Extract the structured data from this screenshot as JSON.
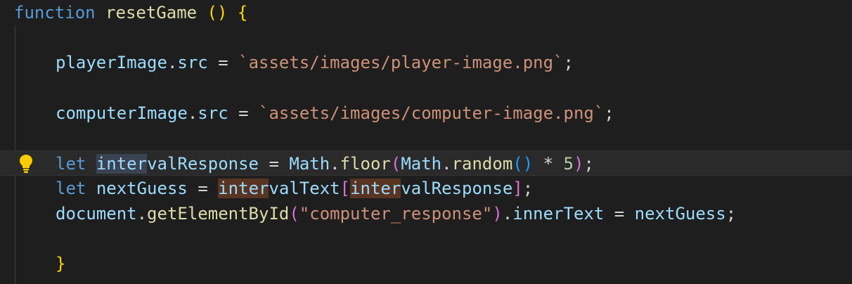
{
  "editor": {
    "lines": [
      {
        "tokens": [
          "function",
          "resetGame",
          "(",
          ")",
          "{"
        ]
      },
      {
        "tokens": []
      },
      {
        "tokens": [
          "playerImage",
          ".",
          "src",
          "=",
          "`assets/images/player-image.png`",
          ";"
        ]
      },
      {
        "tokens": []
      },
      {
        "tokens": [
          "computerImage",
          ".",
          "src",
          "=",
          "`assets/images/computer-image.png`",
          ";"
        ]
      },
      {
        "tokens": []
      },
      {
        "tokens": [
          "let",
          "inter",
          "valResponse",
          "=",
          "Math",
          ".",
          "floor",
          "(",
          "Math",
          ".",
          "random",
          "(",
          ")",
          "*",
          "5",
          ")",
          ";"
        ]
      },
      {
        "tokens": [
          "let",
          "nextGuess",
          "=",
          "inter",
          "valText",
          "[",
          "inter",
          "valResponse",
          "]",
          ";"
        ]
      },
      {
        "tokens": [
          "document",
          ".",
          "getElementById",
          "(",
          "\"computer_response\"",
          ")",
          ".",
          "innerText",
          "=",
          "nextGuess",
          ";"
        ]
      },
      {
        "tokens": []
      },
      {
        "tokens": [
          "}"
        ]
      }
    ],
    "lightbulb_icon": "lightbulb-icon",
    "colors": {
      "background": "#1e1e1e",
      "keyword": "#569cd6",
      "function": "#dcdcaa",
      "variable": "#9cdcfe",
      "string": "#ce9178",
      "number": "#b5cea8",
      "bracket_level1": "#ffd700",
      "bracket_level2": "#da70d6",
      "bracket_level3": "#179fff",
      "selection": "#3a4352",
      "word_highlight": "#5a3422"
    }
  }
}
